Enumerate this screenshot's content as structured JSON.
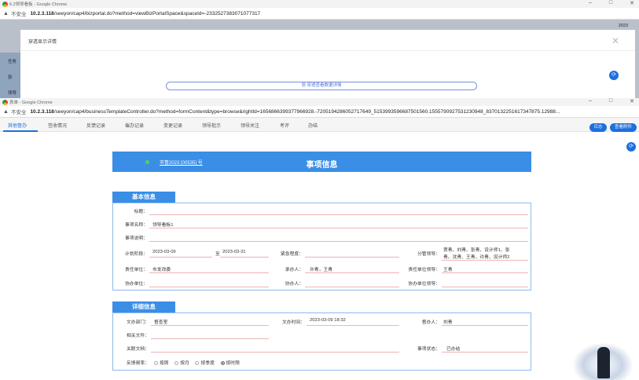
{
  "win1": {
    "title": "6.2领导看板 - Google Chrome",
    "insecure": "不安全",
    "url_host": "10.2.3.118",
    "url_path": "/seeyon/cap4/bizportal.do?method=viewBizPortalSpace&spaceId=-2332527383071077317",
    "bg_year": "2023",
    "bg_rows": [
      "任务",
      "张",
      "领导"
    ],
    "modal_title": "穿透显示详情",
    "modal_button": "穿透查看数据详情"
  },
  "win2": {
    "title": "表单 - Google Chrome",
    "insecure": "不安全",
    "url_host": "10.2.3.118",
    "url_path": "/seeyon/cap4/businessTemplateController.do?method=formContent&type=browse&rightId=1656866399377966928.-7205194286052717649_5153993596687501560.1555790927531230948_8370132251617347875.12988..."
  },
  "tabs": [
    "其他督办",
    "签收情况",
    "反馈记录",
    "催办记录",
    "变更记录",
    "领导批示",
    "领导关注",
    "考评",
    "办结"
  ],
  "buttons": {
    "log": "日志",
    "attach": "查看附件"
  },
  "banner": {
    "link": "市督2023 [00535] 号",
    "title": "事项信息"
  },
  "sec1": {
    "head": "基本信息",
    "title_lbl": "标题：",
    "name_lbl": "事项名称：",
    "name_val": "领导看板1",
    "desc_lbl": "事项说明：",
    "plan_lbl": "计划阶段：",
    "plan_from": "2023-03-09",
    "to_lbl": "至",
    "plan_to": "2023-03-31",
    "urgency_lbl": "紧急程度：",
    "leader_lbl": "分管领导：",
    "leader_val1": "贾青、刘青、张青、设计师1、张",
    "leader_val2": "青、沈青、王青、许青、设计师2",
    "unit_lbl": "责任单位：",
    "unit_val": "市发改委",
    "handler_lbl": "承办人：",
    "handler_val": "许青，王青",
    "unitlead_lbl": "责任单位领导：",
    "unitlead_val": "王青",
    "co_lbl": "协办单位：",
    "coh_lbl": "协办人：",
    "colead_lbl": "协办单位领导："
  },
  "sec2": {
    "head": "详细信息",
    "dept_lbl": "文办部门：",
    "dept_val": "督查室",
    "time_lbl": "文办时间：",
    "time_val": "2023-03-09 18:32",
    "sup_lbl": "督办人：",
    "sup_val": "刘青",
    "file_lbl": "相关文件：",
    "doc_lbl": "关联文档：",
    "status_lbl": "事项状态：",
    "status_val": "已办结",
    "freq_lbl": "反馈频率：",
    "freq_opts": [
      "按周",
      "按月",
      "按季度",
      "按时限"
    ],
    "freq_selected": "按时限"
  }
}
